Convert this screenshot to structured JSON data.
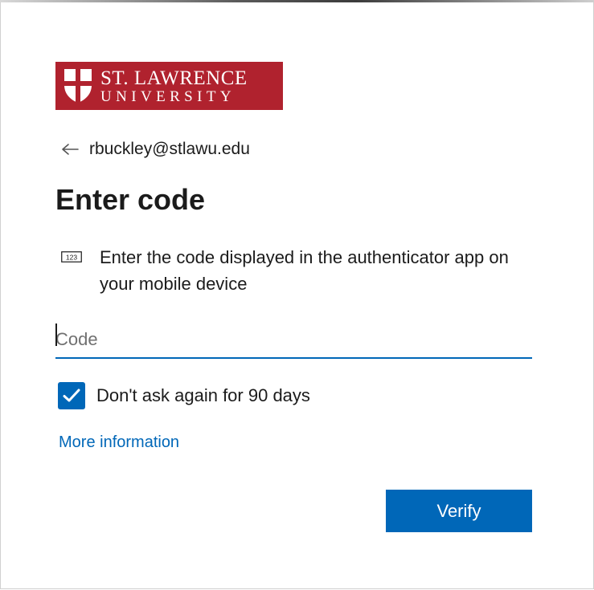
{
  "logo": {
    "line1": "ST. LAWRENCE",
    "line2": "UNIVERSITY",
    "icon": "university-shield-logo"
  },
  "identity": {
    "back_icon": "arrow-left-icon",
    "email": "rbuckley@stlawu.edu"
  },
  "title": "Enter code",
  "instruction": {
    "icon": "numeric-code-icon",
    "text": "Enter the code displayed in the authenticator app on your mobile device"
  },
  "code_input": {
    "placeholder": "Code",
    "value": ""
  },
  "remember": {
    "checked": true,
    "label": "Don't ask again for 90 days"
  },
  "more_info_link": "More information",
  "verify_button": "Verify",
  "colors": {
    "brand": "#b0222e",
    "accent": "#0067b8",
    "text": "#1b1b1b"
  }
}
